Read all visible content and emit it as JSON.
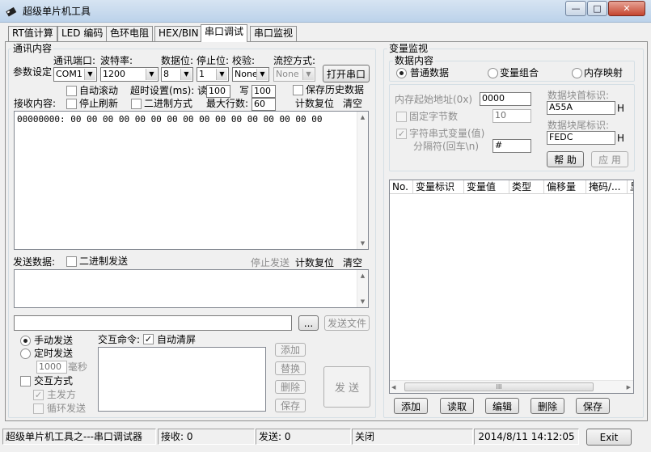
{
  "window": {
    "title": "超级单片机工具",
    "minimize_glyph": "—",
    "maximize_glyph": "□",
    "close_glyph": "✕"
  },
  "tabs": [
    "RT值计算",
    "LED 编码",
    "色环电阻",
    "HEX/BIN",
    "串口调试",
    "串口监视"
  ],
  "comm": {
    "group_title": "通讯内容",
    "params_label": "参数设定",
    "port_label": "通讯端口:",
    "port_value": "COM1",
    "baud_label": "波特率:",
    "baud_value": "1200",
    "databits_label": "数据位:",
    "databits_value": "8",
    "stopbits_label": "停止位:",
    "stopbits_value": "1",
    "parity_label": "校验:",
    "parity_value": "None",
    "flow_label": "流控方式:",
    "flow_value": "None",
    "open_port_button": "打开串口",
    "auto_scroll": "自动滚动",
    "timeout_label": "超时设置(ms): 读",
    "timeout_read": "100",
    "timeout_write_label": "写",
    "timeout_write": "100",
    "save_history": "保存历史数据",
    "receive_label": "接收内容:",
    "stop_refresh": "停止刷新",
    "binary_mode": "二进制方式",
    "max_lines_label": "最大行数:",
    "max_lines": "60",
    "count_reset": "计数复位",
    "clear": "清空",
    "receive_content": "00000000: 00 00 00 00 00 00 00 00 00 00 00 00 00 00 00 00"
  },
  "send": {
    "label": "发送数据:",
    "binary_send": "二进制发送",
    "stop_send": "停止发送",
    "count_reset": "计数复位",
    "clear": "清空",
    "browse_button": "...",
    "send_file_button": "发送文件",
    "manual_send": "手动发送",
    "timed_send": "定时发送",
    "interval_value": "1000",
    "interval_unit": "毫秒",
    "interactive_mode": "交互方式",
    "master_send": "主发方",
    "loop_send": "循环发送",
    "interactive_cmd_label": "交互命令:",
    "auto_clear": "自动清屏",
    "add_button": "添加",
    "replace_button": "替换",
    "delete_button": "删除",
    "save_button": "保存",
    "send_button": "发 送"
  },
  "monitor": {
    "group_title": "变量监视",
    "data_content_title": "数据内容",
    "mode_normal": "普通数据",
    "mode_combo": "变量组合",
    "mode_memmap": "内存映射",
    "mem_start_label": "内存起始地址(0x)",
    "mem_start_value": "0000",
    "fixed_bytes": "固定字节数",
    "fixed_bytes_value": "10",
    "string_var": "字符串式变量(值)",
    "separator_label": "分隔符(回车\\n)",
    "separator_value": "#",
    "head_label": "数据块首标识:",
    "head_value": "A55A",
    "head_suffix": "H",
    "tail_label": "数据块尾标识:",
    "tail_value": "FEDC",
    "tail_suffix": "H",
    "help_button": "帮 助",
    "apply_button": "应 用",
    "columns": [
      "No.",
      "变量标识",
      "变量值",
      "类型",
      "偏移量",
      "掩码/...",
      "显"
    ],
    "hscroll_grip": "III",
    "add_button": "添加",
    "read_button": "读取",
    "edit_button": "编辑",
    "delete_button": "删除",
    "save_button": "保存"
  },
  "status": {
    "app_name": "超级单片机工具之---串口调试器",
    "received": "接收: 0",
    "sent": "发送: 0",
    "port_state": "关闭",
    "datetime": "2014/8/11 14:12:05",
    "exit_button": "Exit"
  },
  "icons": {
    "app": "app-icon",
    "check": "✓",
    "dropdown": "▼",
    "scroll_up": "▲",
    "scroll_down": "▼",
    "scroll_left": "◀",
    "scroll_right": "▶"
  }
}
